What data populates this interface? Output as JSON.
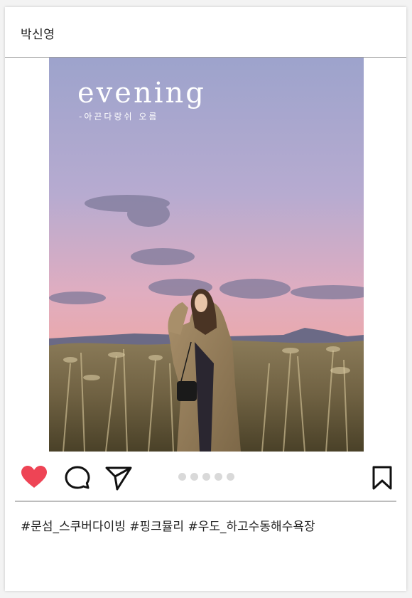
{
  "post": {
    "username": "박신영",
    "image_title": "evening",
    "image_subtitle": "-아끈다랑쉬 오름",
    "caption": "#문섬_스쿠버다이빙 #핑크뮬리 #우도_하고수동해수욕장"
  },
  "actions": {
    "like_icon": "heart-filled-icon",
    "comment_icon": "comment-bubble-icon",
    "share_icon": "paper-plane-icon",
    "save_icon": "bookmark-icon",
    "carousel_dot_count": 5
  },
  "colors": {
    "like": "#ee4455",
    "divider": "#bdbdbd",
    "sky_top": "#9aa0c8",
    "sky_bottom": "#e8a9b2"
  }
}
